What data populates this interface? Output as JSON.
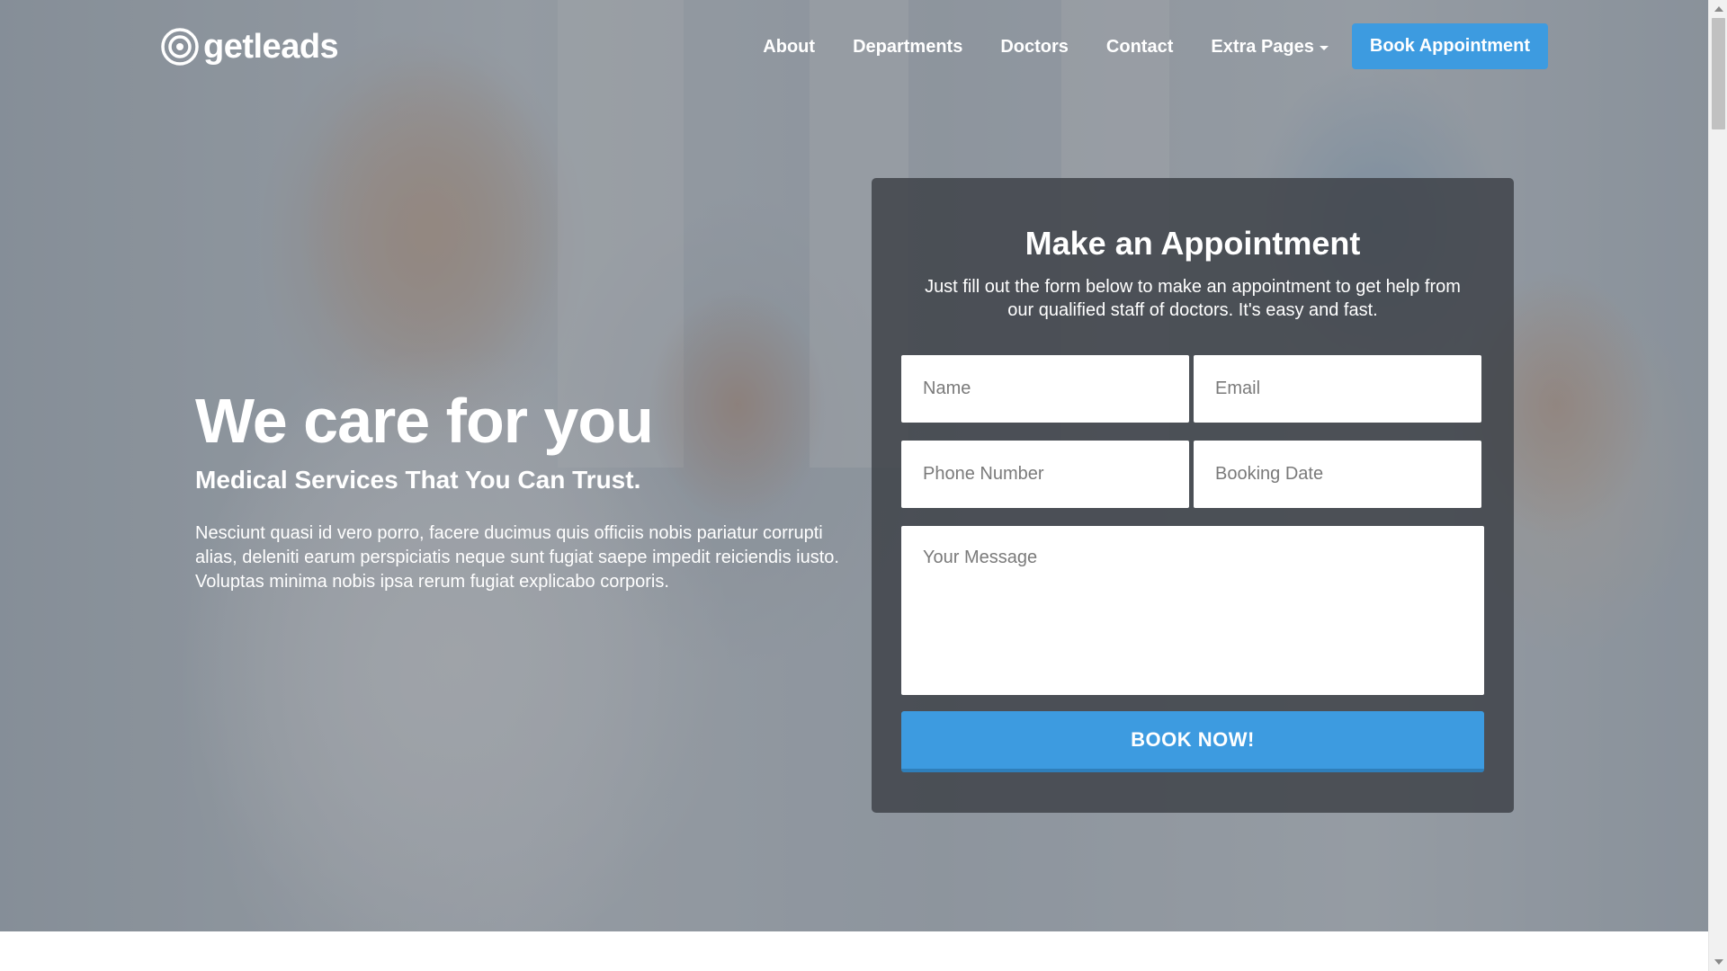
{
  "brand": {
    "name": "getleads",
    "accent": "#3d9be0"
  },
  "nav": {
    "items": [
      {
        "label": "About"
      },
      {
        "label": "Departments"
      },
      {
        "label": "Doctors"
      },
      {
        "label": "Contact"
      },
      {
        "label": "Extra Pages"
      }
    ],
    "cta_label": "Book Appointment"
  },
  "hero": {
    "title": "We care for you",
    "subtitle": "Medical Services That You Can Trust.",
    "body": "Nesciunt quasi id vero porro, facere ducimus quis officiis nobis pariatur corrupti alias, deleniti earum perspiciatis neque sunt fugiat saepe impedit reiciendis iusto. Voluptas minima nobis ipsa rerum fugiat explicabo corporis."
  },
  "form": {
    "title": "Make an Appointment",
    "description": "Just fill out the form below to make an appointment to get help from our qualified staff of doctors. It's easy and fast.",
    "name_placeholder": "Name",
    "email_placeholder": "Email",
    "phone_placeholder": "Phone Number",
    "date_placeholder": "Booking Date",
    "message_placeholder": "Your Message",
    "submit_label": "BOOK NOW!"
  }
}
